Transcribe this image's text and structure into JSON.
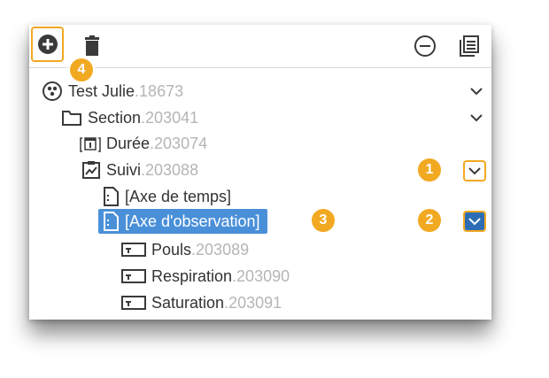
{
  "colors": {
    "accent": "#f2a922",
    "selected": "#4a90d9",
    "muted": "#b5b5b5"
  },
  "toolbar": {
    "add_icon": "plus-circle-icon",
    "delete_icon": "trash-icon",
    "collapse_icon": "minus-circle-icon",
    "list_icon": "list-icon"
  },
  "tree": [
    {
      "label": "Test Julie",
      "suffix": ".18673",
      "icon": "network-icon"
    },
    {
      "label": "Section",
      "suffix": ".203041",
      "icon": "folder-icon"
    },
    {
      "label": "Durée",
      "suffix": ".203074",
      "icon": "calendar-icon"
    },
    {
      "label": "Suivi",
      "suffix": ".203088",
      "icon": "chart-icon"
    },
    {
      "label": "[Axe de temps]",
      "suffix": "",
      "icon": "document-icon"
    },
    {
      "label": "[Axe d'observation]",
      "suffix": "",
      "icon": "document-icon"
    },
    {
      "label": "Pouls",
      "suffix": ".203089",
      "icon": "field-icon"
    },
    {
      "label": "Respiration",
      "suffix": ".203090",
      "icon": "field-icon"
    },
    {
      "label": "Saturation",
      "suffix": ".203091",
      "icon": "field-icon"
    }
  ],
  "badges": {
    "b1": "1",
    "b2": "2",
    "b3": "3",
    "b4": "4"
  }
}
